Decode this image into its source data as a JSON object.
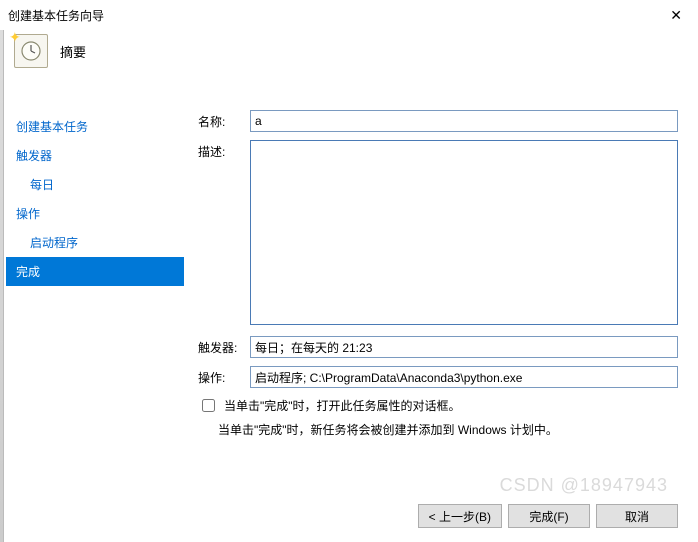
{
  "window": {
    "title": "创建基本任务向导"
  },
  "header": {
    "title": "摘要"
  },
  "sidebar": {
    "items": [
      {
        "label": "创建基本任务",
        "sub": false,
        "selected": false
      },
      {
        "label": "触发器",
        "sub": false,
        "selected": false
      },
      {
        "label": "每日",
        "sub": true,
        "selected": false
      },
      {
        "label": "操作",
        "sub": false,
        "selected": false
      },
      {
        "label": "启动程序",
        "sub": true,
        "selected": false
      },
      {
        "label": "完成",
        "sub": false,
        "selected": true
      }
    ]
  },
  "form": {
    "name_label": "名称:",
    "name_value": "a",
    "desc_label": "描述:",
    "desc_value": "",
    "trigger_label": "触发器:",
    "trigger_value": "每日；在每天的 21:23",
    "action_label": "操作:",
    "action_value": "启动程序; C:\\ProgramData\\Anaconda3\\python.exe",
    "checkbox_label": "当单击\"完成\"时，打开此任务属性的对话框。",
    "info_text": "当单击\"完成\"时，新任务将会被创建并添加到 Windows 计划中。"
  },
  "buttons": {
    "back": "< 上一步(B)",
    "finish": "完成(F)",
    "cancel": "取消"
  },
  "watermark": "CSDN @18947943"
}
